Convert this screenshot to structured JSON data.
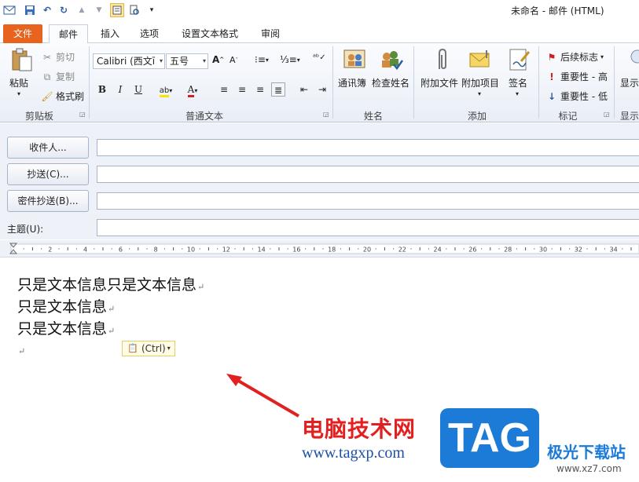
{
  "title": "未命名 - 邮件 (HTML)",
  "tabs": [
    "文件",
    "邮件",
    "插入",
    "选项",
    "设置文本格式",
    "审阅"
  ],
  "clipboard": {
    "paste": "粘贴",
    "cut": "剪切",
    "copy": "复制",
    "format_painter": "格式刷",
    "label": "剪贴板"
  },
  "basic_text": {
    "font": "Calibri (西文ī",
    "size": "五号",
    "label": "普通文本"
  },
  "names": {
    "address_book": "通讯簿",
    "check_names": "检查姓名",
    "label": "姓名"
  },
  "include": {
    "attach_file": "附加文件",
    "attach_item": "附加项目",
    "signature": "签名",
    "label": "添加"
  },
  "tags": {
    "follow_up": "后续标志",
    "high_importance": "重要性 - 高",
    "low_importance": "重要性 - 低",
    "label": "标记"
  },
  "show": {
    "partial": "显示",
    "label": "显示"
  },
  "address": {
    "to": "收件人...",
    "cc": "抄送(C)...",
    "bcc": "密件抄送(B)...",
    "subject": "主题(U):"
  },
  "ruler_ticks": [
    "2",
    "4",
    "6",
    "8",
    "10",
    "12",
    "14",
    "16",
    "18",
    "20",
    "22",
    "24",
    "26",
    "28",
    "30",
    "32",
    "34"
  ],
  "body_lines": [
    "只是文本信息只是文本信息",
    "只是文本信息",
    "只是文本信息"
  ],
  "paste_options": "(Ctrl)",
  "watermark": {
    "site_name": "电脑技术网",
    "url": "www.tagxp.com",
    "tag": "TAG",
    "brand": "极光下载站",
    "brand_url": "www.xz7.com"
  },
  "colors": {
    "file_tab": "#e8631d",
    "watermark_red": "#e32020",
    "watermark_blue": "#1b7bd6"
  }
}
